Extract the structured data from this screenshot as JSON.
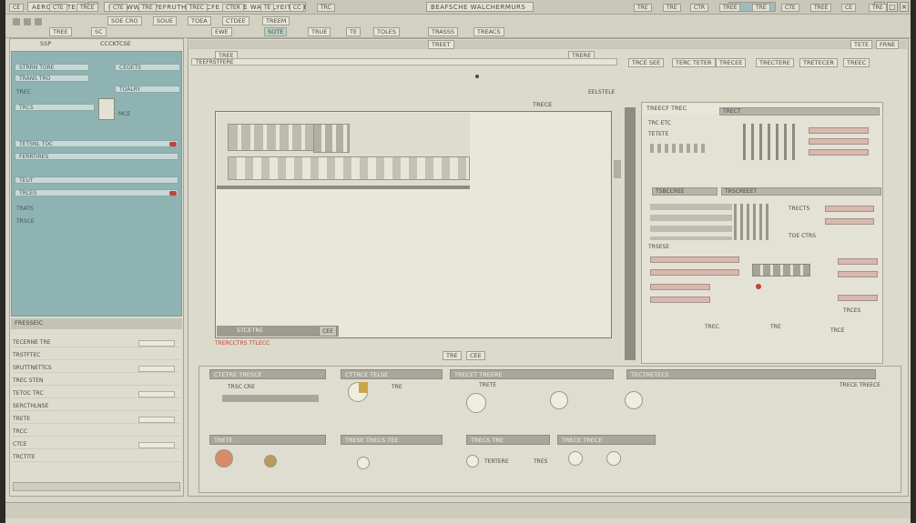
{
  "window": {
    "title_left": "AEROXEWTE",
    "title_mid": "BESEWWE TWEFRUTHR DCICFE COMSE WAWCLYEITTE THSER",
    "title_right": "BEAFSCHE WALCHERMURS",
    "win_controls": [
      "—",
      "□",
      "×"
    ]
  },
  "toolbar": {
    "items": [
      "SOE CRO",
      "SOUE",
      "TOEA",
      "CTDEE",
      "TREEM",
      "TRUE",
      "TE",
      "TOLES",
      "SOTE",
      "EWE",
      "SC",
      "TREE",
      "TRASSS",
      "TREACS"
    ]
  },
  "left_panel": {
    "header": "SSP",
    "header2": "CCCKTCSE",
    "teal_rows": [
      "STRRN TORE",
      "TRANS TRO",
      "CEOETS",
      "TOALRY",
      "TRCS",
      "TETSNL TOC",
      "FERRTIRES",
      "TEUT",
      "TRCES"
    ],
    "teal_labels": [
      "TREC",
      "MCE",
      "TRATS",
      "TRSCE"
    ],
    "section_title": "FRESSEIC",
    "rows": [
      "TECERNE TRE",
      "TRSTFTEC",
      "SRUTTNETTCS",
      "TREC STEN",
      "TETOC TRC",
      "SERCTHLNSE",
      "TRETE",
      "TRCC",
      "CTCE",
      "TRCTITE"
    ]
  },
  "main": {
    "tabs": [
      "TREET",
      "TETE",
      "FRNE",
      "TREE",
      "TRERE"
    ],
    "header_left": "TEEFRSTFERE",
    "header_right": "EELSTELE",
    "sub_tags": [
      "TRCE SEE",
      "TERC TETER",
      "TRECEE",
      "TRECTERE",
      "TRETECER",
      "TREEC"
    ],
    "canvas_title": "TRECE",
    "canvas_footer": "STCETRE",
    "canvas_footer_red": "TRERCCTRS TTLECC",
    "canvas_btn": "CEE",
    "canvas_nav": [
      "TRE",
      "CEE"
    ]
  },
  "right_panel": {
    "header": "TREECF TREC",
    "header2": "TRECT",
    "mid_bar": "TSBCCREE",
    "mid_bar2": "TRSCREEET",
    "labels": [
      "TRC ETC",
      "TETETE",
      "TRECTS",
      "TOE CTRS",
      "TRSESE",
      "TRCES",
      "TREC",
      "TRE",
      "TRCE"
    ]
  },
  "bottom_panel": {
    "heads": [
      "CTETRE TRESCE",
      "CTTRCE TELSE",
      "TRECET TREERE",
      "TECTRETECE",
      "TRETE",
      "TRESE TRECS TEE",
      "TRECS TRE",
      "TRECE TRECE"
    ],
    "labels": [
      "TRSC CRE",
      "TRE",
      "TRETE",
      "TRECE TREECE",
      "TERTERE",
      "TRES"
    ]
  },
  "status": {
    "left": "CE",
    "items": [
      "CTE",
      "TRCE",
      "CTE",
      "TRE",
      "TREC",
      "CTER",
      "TE",
      "CC",
      "TRC"
    ],
    "right": [
      "TRE",
      "TRE",
      "CTR",
      "TREE",
      "TRE",
      "CTE",
      "TREE",
      "CE",
      "TRE"
    ]
  },
  "colors": {
    "teal": "#8fb3b3",
    "accent_red": "#c0443a",
    "panel": "#dcdacb"
  }
}
